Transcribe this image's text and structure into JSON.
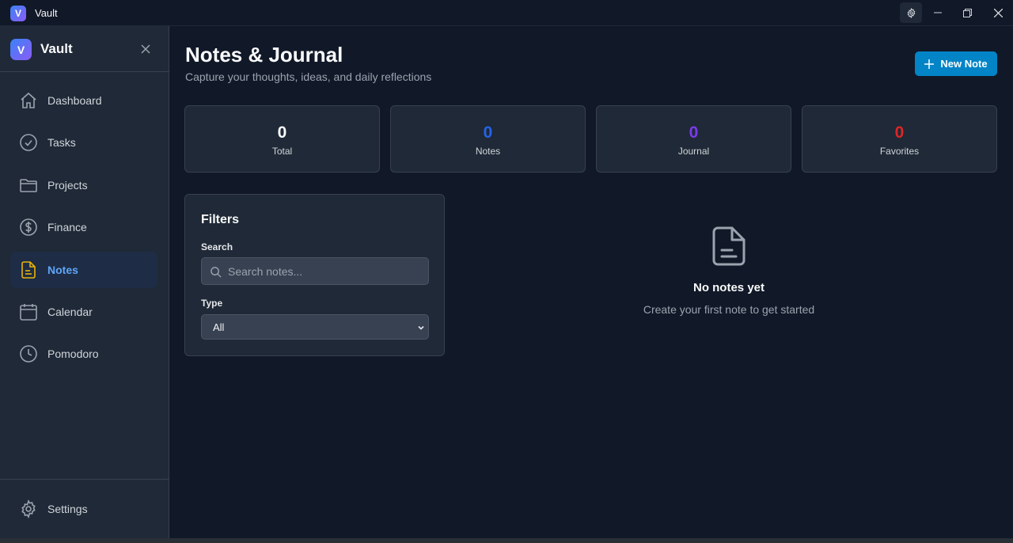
{
  "window": {
    "title": "Vault",
    "logo_letter": "V"
  },
  "sidebar": {
    "title": "Vault",
    "logo_letter": "V",
    "items": [
      {
        "label": "Dashboard",
        "icon": "home-icon"
      },
      {
        "label": "Tasks",
        "icon": "check-circle-icon"
      },
      {
        "label": "Projects",
        "icon": "folder-icon"
      },
      {
        "label": "Finance",
        "icon": "dollar-circle-icon"
      },
      {
        "label": "Notes",
        "icon": "note-icon",
        "active": true
      },
      {
        "label": "Calendar",
        "icon": "calendar-icon"
      },
      {
        "label": "Pomodoro",
        "icon": "clock-icon"
      }
    ],
    "footer": {
      "label": "Settings",
      "icon": "gear-icon"
    }
  },
  "header": {
    "title": "Notes & Journal",
    "subtitle": "Capture your thoughts, ideas, and daily reflections",
    "new_note_label": "New Note"
  },
  "stats": [
    {
      "value": "0",
      "label": "Total",
      "color": "#f9fafb"
    },
    {
      "value": "0",
      "label": "Notes",
      "color": "#2563eb"
    },
    {
      "value": "0",
      "label": "Journal",
      "color": "#7c3aed"
    },
    {
      "value": "0",
      "label": "Favorites",
      "color": "#dc2626"
    }
  ],
  "filters": {
    "title": "Filters",
    "search_label": "Search",
    "search_placeholder": "Search notes...",
    "type_label": "Type",
    "type_value": "All"
  },
  "empty_state": {
    "title": "No notes yet",
    "subtitle": "Create your first note to get started"
  },
  "colors": {
    "accent": "#0284c7",
    "active_nav": "#60a5fa",
    "notes_icon": "#eab308"
  }
}
